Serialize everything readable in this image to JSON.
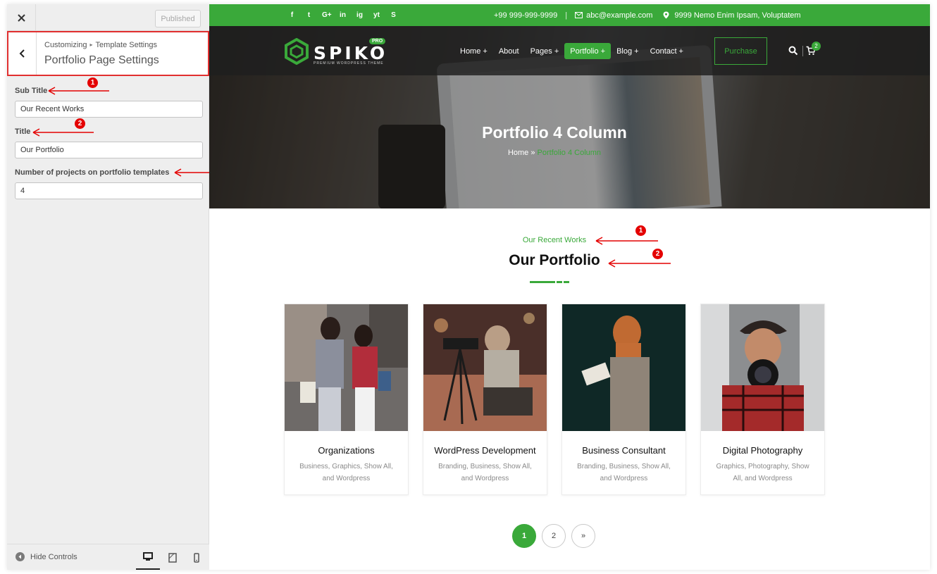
{
  "customizer": {
    "published_label": "Published",
    "breadcrumb": {
      "root": "Customizing",
      "section": "Template Settings"
    },
    "section_title": "Portfolio Page Settings",
    "controls": {
      "subtitle": {
        "label": "Sub Title",
        "value": "Our Recent Works"
      },
      "title": {
        "label": "Title",
        "value": "Our Portfolio"
      },
      "projects": {
        "label": "Number of projects on portfolio templates",
        "value": "4"
      }
    },
    "hide_controls_label": "Hide Controls",
    "devices": [
      "desktop-icon",
      "tablet-icon",
      "mobile-icon"
    ],
    "annotation_badges": [
      "1",
      "2"
    ]
  },
  "site": {
    "topbar": {
      "social": [
        "f",
        "t",
        "G+",
        "in",
        "ig",
        "yt",
        "S"
      ],
      "phone": "+99 999-999-9999",
      "separator": "|",
      "email": "abc@example.com",
      "address": "9999 Nemo Enim Ipsam, Voluptatem"
    },
    "logo": {
      "name": "SPIKO",
      "tagline": "PREMIUM WORDPRESS THEME",
      "badge": "PRO"
    },
    "menu": [
      "Home +",
      "About",
      "Pages +",
      "Portfolio +",
      "Blog +",
      "Contact +"
    ],
    "active_menu": "Portfolio +",
    "purchase_label": "Purchase",
    "cart_count": "2",
    "hero": {
      "title": "Portfolio 4 Column",
      "crumb_home": "Home",
      "crumb_sep": "»",
      "crumb_current": "Portfolio 4 Column"
    },
    "section": {
      "subtitle": "Our Recent Works",
      "title": "Our Portfolio"
    },
    "cards": [
      {
        "title": "Organizations",
        "tags": "Business, Graphics, Show All, and Wordpress"
      },
      {
        "title": "WordPress Development",
        "tags": "Branding, Business, Show All, and Wordpress"
      },
      {
        "title": "Business Consultant",
        "tags": "Branding, Business, Show All, and Wordpress"
      },
      {
        "title": "Digital Photography",
        "tags": "Graphics, Photography, Show All, and Wordpress"
      }
    ],
    "pagination": [
      "1",
      "2",
      "»"
    ],
    "active_page": "1"
  },
  "colors": {
    "accent": "#3aa93a",
    "annotation": "#e40000",
    "highlight_border": "#e12f2f"
  }
}
